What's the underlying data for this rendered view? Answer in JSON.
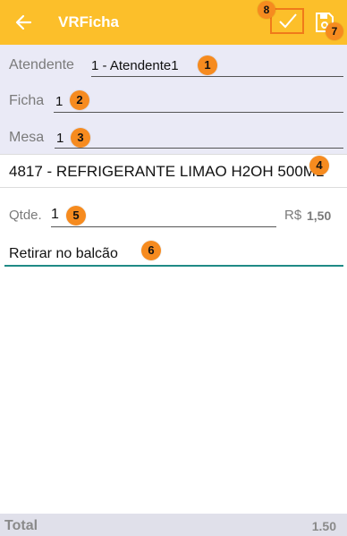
{
  "appbar": {
    "title": "VRFicha",
    "back_icon": "arrow-left-icon",
    "confirm_icon": "check-icon",
    "save_icon": "floppy-disk-icon",
    "background": "#fcbf2a"
  },
  "form": {
    "atendente": {
      "label": "Atendente",
      "value": "1 - Atendente1"
    },
    "ficha": {
      "label": "Ficha",
      "value": "1"
    },
    "mesa": {
      "label": "Mesa",
      "value": "1"
    },
    "product": "4817 - REFRIGERANTE LIMAO H2OH 500ML",
    "quantity": {
      "label": "Qtde.",
      "value": "1"
    },
    "price": {
      "currency": "R$",
      "value": "1,50"
    },
    "observation": "Retirar no balcão"
  },
  "totals": {
    "label": "Total",
    "value": "1.50"
  },
  "markers": [
    "1",
    "2",
    "3",
    "4",
    "5",
    "6",
    "7",
    "8"
  ],
  "colors": {
    "marker": "#f68b1f",
    "accent_line": "#1f8a86",
    "header_panel": "#eaeaf6"
  }
}
